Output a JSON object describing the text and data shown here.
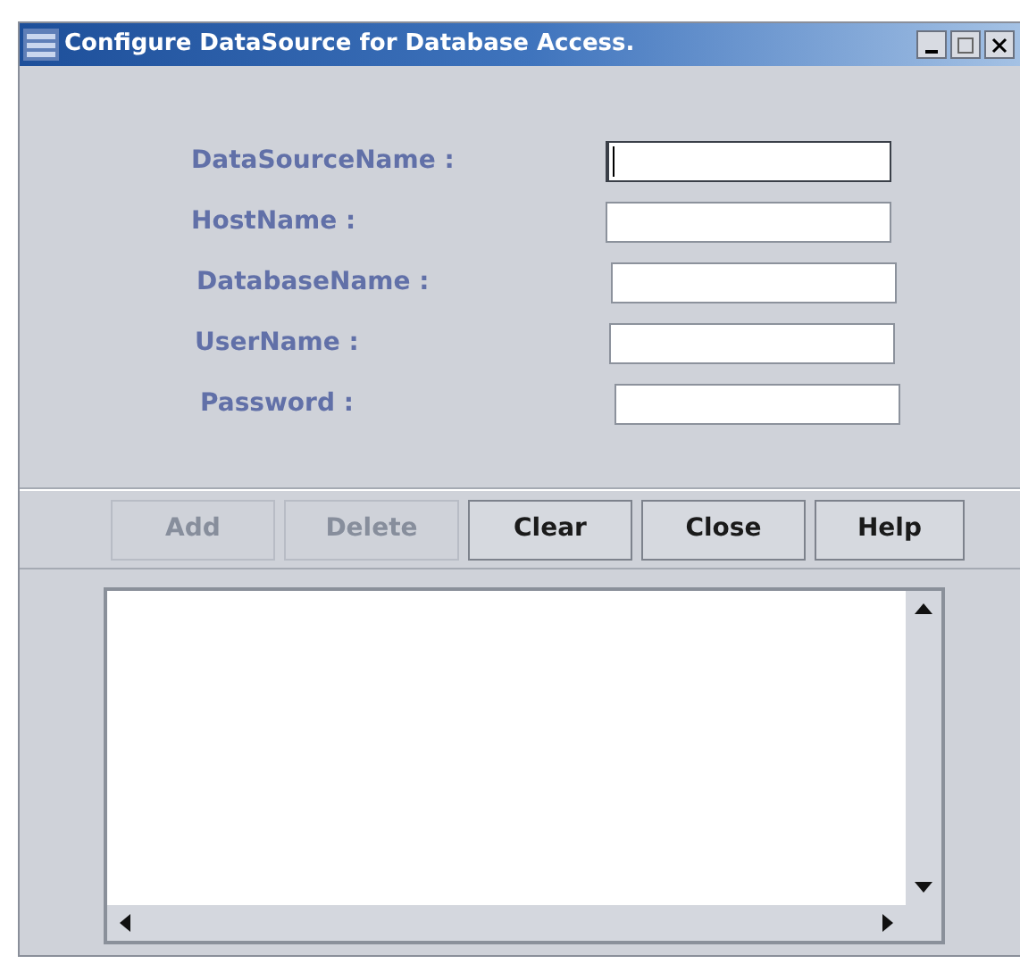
{
  "window": {
    "title": "Configure DataSource for Database Access."
  },
  "fields": [
    {
      "label": "DataSourceName :",
      "focused": true
    },
    {
      "label": "HostName :",
      "focused": false
    },
    {
      "label": "DatabaseName :",
      "focused": false
    },
    {
      "label": "UserName :",
      "focused": false
    },
    {
      "label": "Password :",
      "focused": false
    }
  ],
  "buttons": [
    {
      "label": "Add",
      "disabled": true
    },
    {
      "label": "Delete",
      "disabled": true
    },
    {
      "label": "Clear",
      "disabled": false
    },
    {
      "label": "Close",
      "disabled": false
    },
    {
      "label": "Help",
      "disabled": false
    }
  ]
}
